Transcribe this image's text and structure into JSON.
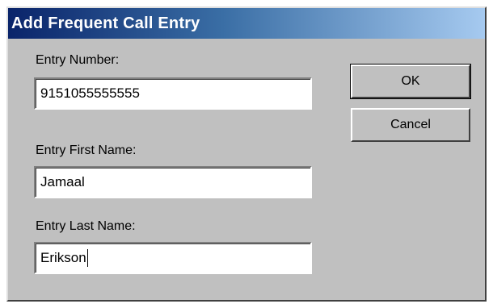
{
  "window": {
    "title": "Add Frequent Call Entry"
  },
  "form": {
    "entry_number": {
      "label": "Entry Number:",
      "value": "9151055555555"
    },
    "first_name": {
      "label": "Entry First Name:",
      "value": "Jamaal"
    },
    "last_name": {
      "label": "Entry Last Name:",
      "value": "Erikson"
    }
  },
  "buttons": {
    "ok_label": "OK",
    "cancel_label": "Cancel"
  },
  "colors": {
    "titlebar_start": "#0a246a",
    "titlebar_end": "#a6caf0",
    "dialog_face": "#c0c0c0"
  }
}
